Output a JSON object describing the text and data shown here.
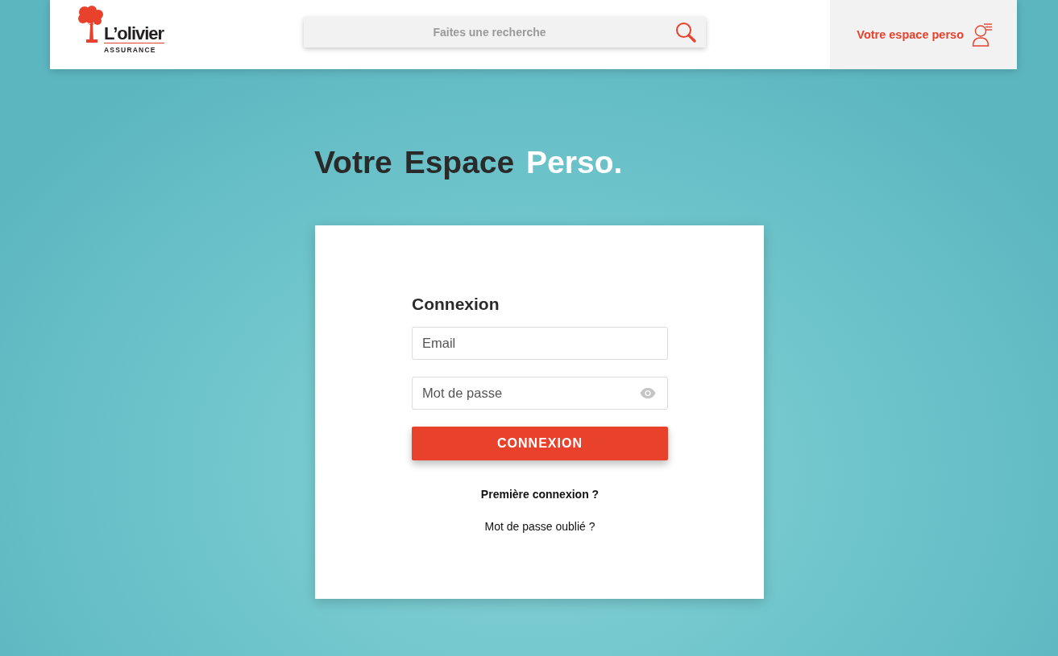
{
  "header": {
    "logo": {
      "name": "L’olivier",
      "tagline": "ASSURANCE"
    },
    "search": {
      "placeholder": "Faites une recherche"
    },
    "account_link": {
      "label": "Votre espace perso"
    }
  },
  "title": {
    "text": "Votre Espace",
    "accent": "Perso."
  },
  "login": {
    "heading": "Connexion",
    "fields": [
      {
        "kind": "email",
        "placeholder": "Email"
      },
      {
        "kind": "password",
        "placeholder": "Mot de passe"
      }
    ],
    "submit": "CONNEXION",
    "links": [
      {
        "kind": "primary",
        "label": "Première connexion ?"
      },
      {
        "kind": "secondary",
        "label": "Mot de passe oublié ?"
      }
    ]
  }
}
